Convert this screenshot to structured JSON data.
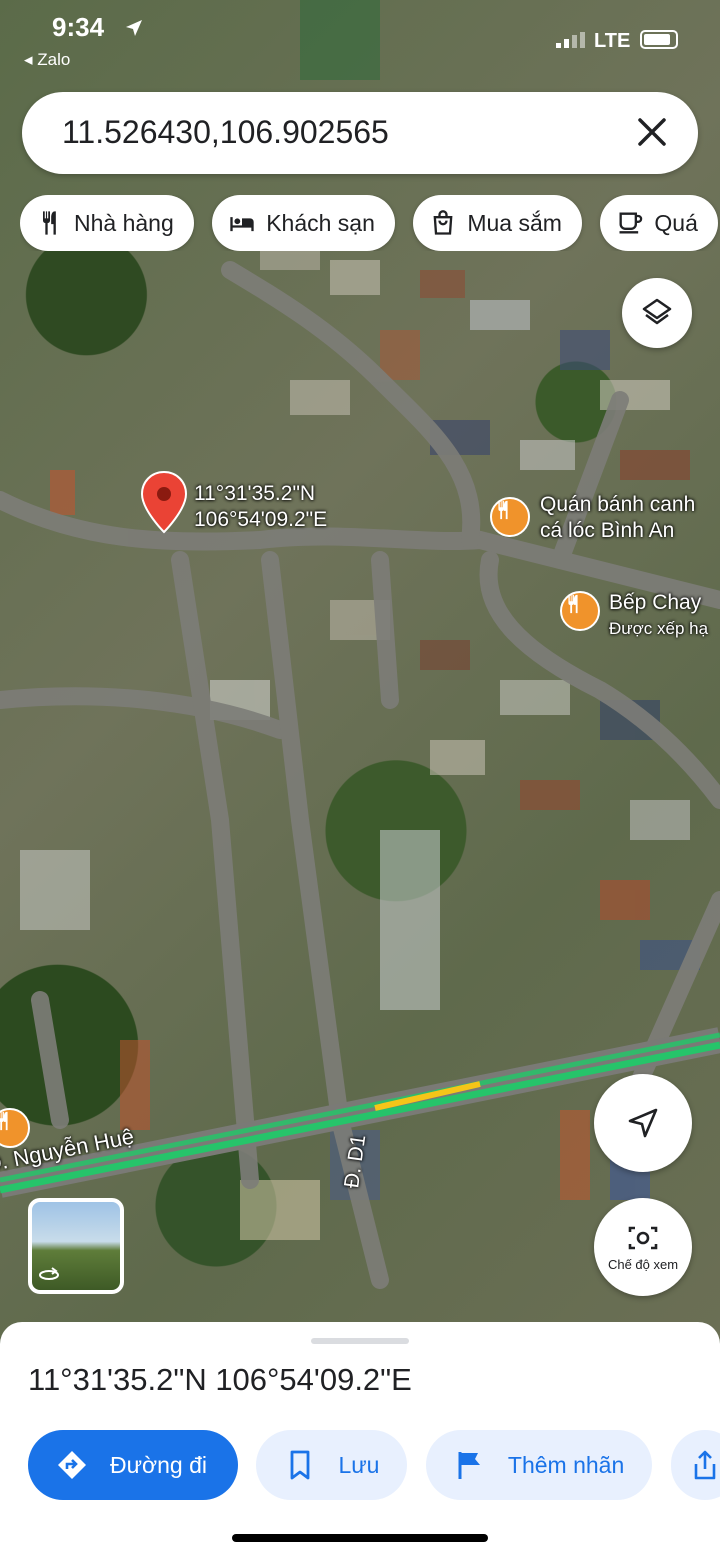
{
  "status_bar": {
    "time": "9:34",
    "back_app": "◂ Zalo",
    "network": "LTE"
  },
  "search": {
    "query": "11.526430,106.902565",
    "clear_icon": "close-icon"
  },
  "chips": [
    {
      "label": "Nhà hàng",
      "icon": "restaurant-icon"
    },
    {
      "label": "Khách sạn",
      "icon": "hotel-icon"
    },
    {
      "label": "Mua sắm",
      "icon": "shopping-bag-icon"
    },
    {
      "label": "Quá",
      "icon": "coffee-icon"
    }
  ],
  "map": {
    "pin_label_line1": "11°31'35.2\"N",
    "pin_label_line2": "106°54'09.2\"E",
    "places": [
      {
        "line1": "Quán bánh canh",
        "line2": "cá lóc Bình An"
      },
      {
        "line1": "Bếp Chay",
        "line2": "Được xếp hạ"
      }
    ],
    "streets": {
      "main": "Đ. Nguyễn Huệ",
      "side": "Đ. D1"
    },
    "colors": {
      "pin": "#ea4335",
      "poi": "#f0932b",
      "traffic_green": "#26c46a",
      "traffic_yellow": "#f5c518"
    }
  },
  "camera_button": {
    "label": "Chế độ xem"
  },
  "sheet": {
    "coordinates": "11°31'35.2\"N 106°54'09.2\"E",
    "actions": [
      {
        "label": "Đường đi",
        "icon": "directions-icon"
      },
      {
        "label": "Lưu",
        "icon": "bookmark-icon"
      },
      {
        "label": "Thêm nhãn",
        "icon": "flag-icon"
      }
    ],
    "share_icon": "share-icon"
  }
}
